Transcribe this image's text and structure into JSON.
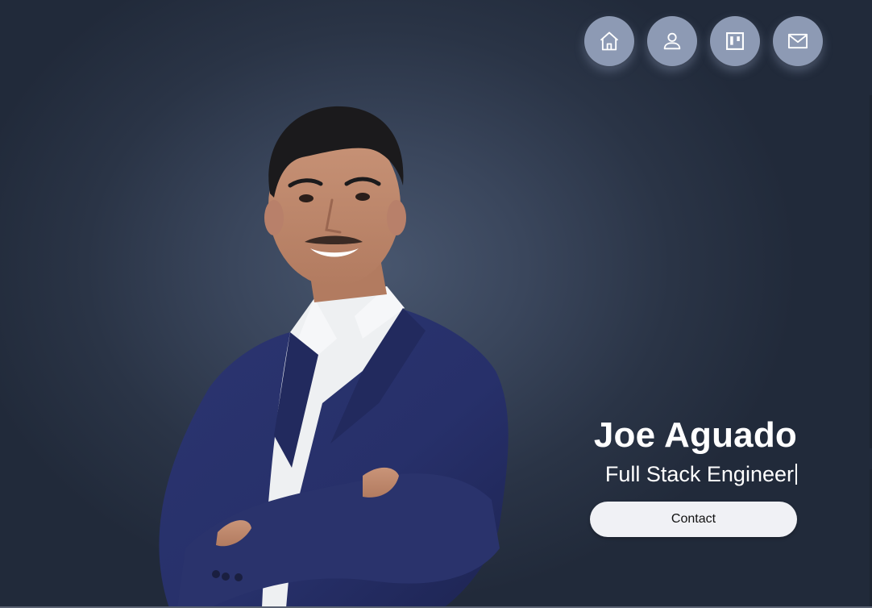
{
  "nav": {
    "items": [
      {
        "icon": "home-icon"
      },
      {
        "icon": "user-icon"
      },
      {
        "icon": "kanban-icon"
      },
      {
        "icon": "mail-icon"
      }
    ]
  },
  "hero": {
    "name": "Joe Aguado",
    "title": "Full Stack Engineer",
    "contact_label": "Contact"
  },
  "colors": {
    "background": "#2a3446",
    "nav_button": "#8d9ab4",
    "contact_button": "#f0f1f5",
    "text": "#ffffff"
  }
}
